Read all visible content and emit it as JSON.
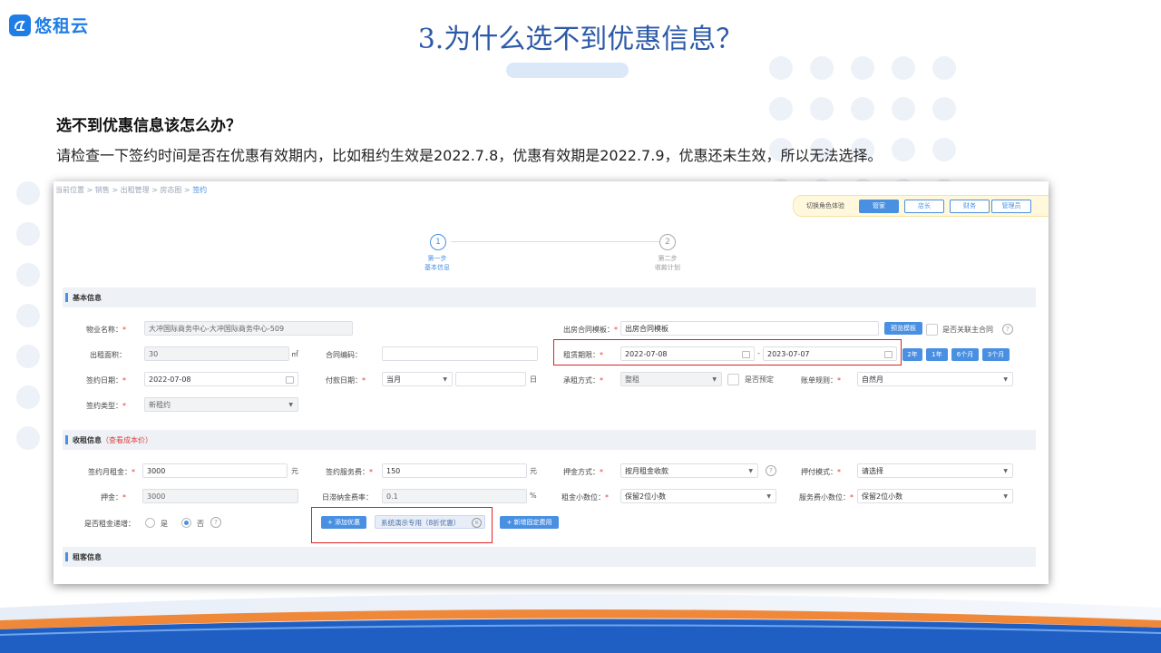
{
  "brand": {
    "name": "悠租云",
    "color": "#1f7de6"
  },
  "slide": {
    "title": "3.为什么选不到优惠信息？",
    "question": "选不到优惠信息该怎么办？",
    "answer": "请检查一下签约时间是否在优惠有效期内，比如租约生效是2022.7.8，优惠有效期是2022.7.9，优惠还未生效，所以无法选择。"
  },
  "screenshot": {
    "breadcrumb": [
      "当前位置",
      "销售",
      "出租管理",
      "房态图",
      "签约"
    ],
    "role_switch": {
      "label": "切换角色体验",
      "roles": [
        "管家",
        "店长",
        "财务",
        "管理员"
      ],
      "active": "管家"
    },
    "steps": [
      {
        "num": "1",
        "line1": "第一步",
        "line2": "基本信息"
      },
      {
        "num": "2",
        "line1": "第二步",
        "line2": "收款计划"
      }
    ],
    "basic": {
      "title": "基本信息",
      "property_label": "物业名称：",
      "property_value": "大冲国际商务中心-大冲国际商务中心-509",
      "area_label": "出租面积：",
      "area_value": "30",
      "area_unit": "㎡",
      "contract_no_label": "合同编码：",
      "sign_date_label": "签约日期：",
      "sign_date_value": "2022-07-08",
      "pay_date_label": "付款日期：",
      "pay_date_value": "当月",
      "pay_date_unit": "日",
      "sign_type_label": "签约类型：",
      "sign_type_value": "新租约",
      "template_label": "出房合同模板：",
      "template_value": "出房合同模板",
      "preview_button": "预览模板",
      "link_main_label": "是否关联主合同",
      "term_label": "租赁期限：",
      "term_start": "2022-07-08",
      "term_sep": "-",
      "term_end": "2023-07-07",
      "term_buttons": [
        "2年",
        "1年",
        "6个月",
        "3个月"
      ],
      "rent_mode_label": "承租方式：",
      "rent_mode_value": "整租",
      "reserve_label": "是否预定",
      "bill_rule_label": "账单规则：",
      "bill_rule_value": "自然月"
    },
    "rent": {
      "title": "收租信息",
      "view_cost": "（查看成本价）",
      "monthly_rent_label": "签约月租金：",
      "monthly_rent_value": "3000",
      "unit_yuan": "元",
      "deposit_label": "押金：",
      "deposit_value": "3000",
      "increase_label": "是否租金递增：",
      "yes": "是",
      "no": "否",
      "service_fee_label": "签约服务费：",
      "service_fee_value": "150",
      "late_fee_label": "日滞纳金费率：",
      "late_fee_value": "0.1",
      "percent": "%",
      "add_discount_button": "+ 添加优惠",
      "discount_tag": "系统演示专用（8折优惠）",
      "add_fixed_fee_button": "+ 新增固定费用",
      "deposit_mode_label": "押金方式：",
      "deposit_mode_value": "按月租金收款",
      "decimal_label": "租金小数位：",
      "decimal_value": "保留2位小数",
      "pay_mode_label": "押付模式：",
      "pay_mode_value": "请选择",
      "service_decimal_label": "服务费小数位：",
      "service_decimal_value": "保留2位小数"
    },
    "tenant": {
      "title": "租客信息"
    }
  }
}
